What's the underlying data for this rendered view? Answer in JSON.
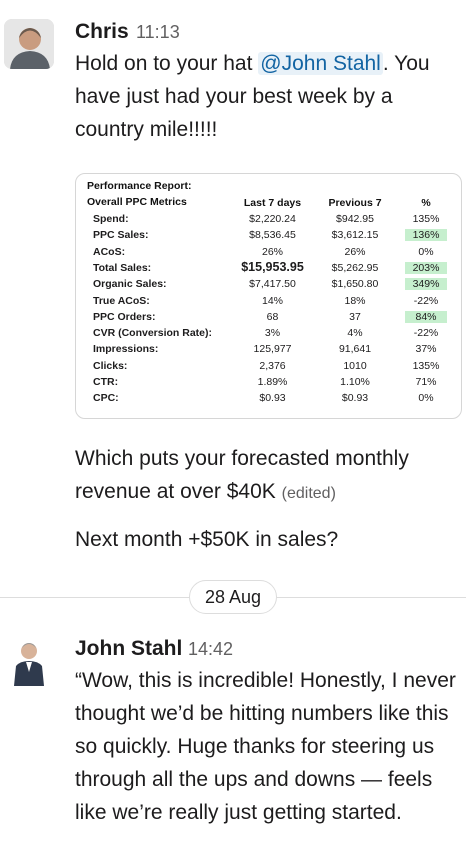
{
  "messages": [
    {
      "author": "Chris",
      "time": "11:13",
      "text_before_mention": "Hold on to your hat ",
      "mention": "@John Stahl",
      "text_after_mention": ". You have just had your best week by a country mile!!!!!",
      "followups": [
        {
          "text": "Which puts your forecasted monthly revenue at over $40K",
          "edited": "(edited)"
        },
        {
          "text": "Next month +$50K in sales?"
        }
      ]
    },
    {
      "author": "John Stahl",
      "time": "14:42",
      "text": "“Wow, this is incredible! Honestly, I never thought we’d be hitting numbers like this so quickly. Huge thanks for steering us through all the ups and downs — feels like we’re really just getting started."
    }
  ],
  "date_divider": "28 Aug",
  "report": {
    "title": "Performance Report:",
    "subtitle": "Overall PPC Metrics",
    "columns": [
      "Last 7 days",
      "Previous 7",
      "%"
    ],
    "rows": [
      {
        "label": "Spend:",
        "last": "$2,220.24",
        "prev": "$942.95",
        "pct": "135%",
        "hl": false
      },
      {
        "label": "PPC Sales:",
        "last": "$8,536.45",
        "prev": "$3,612.15",
        "pct": "136%",
        "hl": true
      },
      {
        "label": "ACoS:",
        "last": "26%",
        "prev": "26%",
        "pct": "0%",
        "hl": false
      },
      {
        "label": "Total Sales:",
        "last": "$15,953.95",
        "prev": "$5,262.95",
        "pct": "203%",
        "hl": true,
        "bold": true
      },
      {
        "label": "Organic Sales:",
        "last": "$7,417.50",
        "prev": "$1,650.80",
        "pct": "349%",
        "hl": true
      },
      {
        "label": "True ACoS:",
        "last": "14%",
        "prev": "18%",
        "pct": "-22%",
        "hl": false
      },
      {
        "label": "PPC Orders:",
        "last": "68",
        "prev": "37",
        "pct": "84%",
        "hl": true
      },
      {
        "label": "CVR (Conversion Rate):",
        "last": "3%",
        "prev": "4%",
        "pct": "-22%",
        "hl": false
      },
      {
        "label": "Impressions:",
        "last": "125,977",
        "prev": "91,641",
        "pct": "37%",
        "hl": false
      },
      {
        "label": "Clicks:",
        "last": "2,376",
        "prev": "1010",
        "pct": "135%",
        "hl": false
      },
      {
        "label": "CTR:",
        "last": "1.89%",
        "prev": "1.10%",
        "pct": "71%",
        "hl": false
      },
      {
        "label": "CPC:",
        "last": "$0.93",
        "prev": "$0.93",
        "pct": "0%",
        "hl": false
      }
    ],
    "highlight_color": "#c6efce"
  }
}
